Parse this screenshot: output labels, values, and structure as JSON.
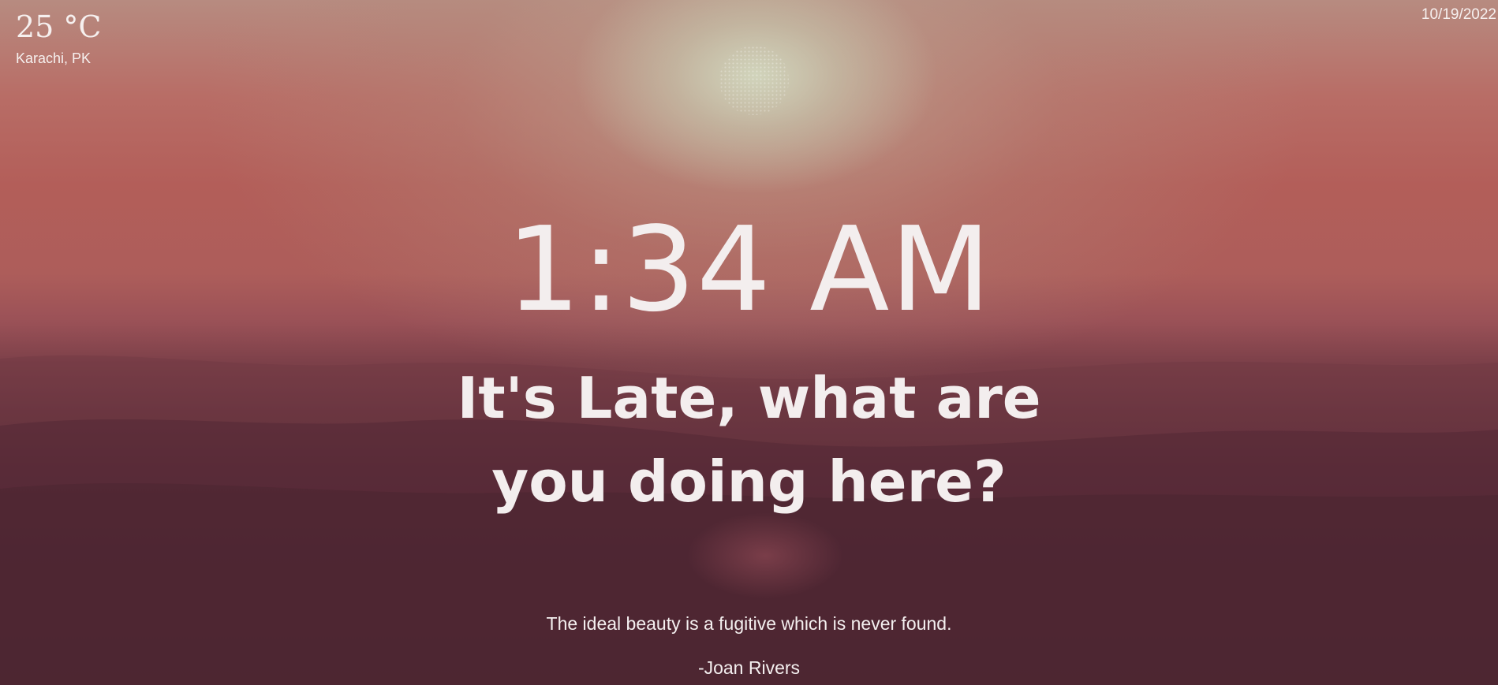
{
  "weather": {
    "temperature": "25 °C",
    "location": "Karachi, PK"
  },
  "date": "10/19/2022",
  "clock": {
    "time": "1:34 AM"
  },
  "greeting": "It's Late, what are you doing here?",
  "quote": {
    "text": "The ideal beauty is a fugitive which is never found.",
    "author": "-Joan Rivers"
  }
}
